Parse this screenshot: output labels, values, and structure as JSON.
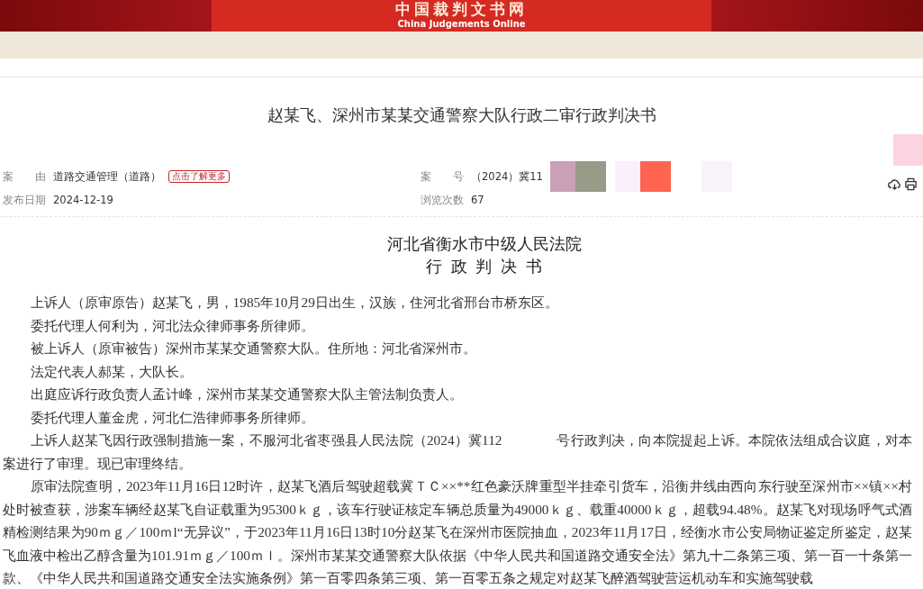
{
  "site": {
    "logo_text": "中国裁判文书网",
    "logo_subtitle": "China Judgements Online"
  },
  "document": {
    "title": "赵某飞、深州市某某交通警察大队行政二审行政判决书"
  },
  "meta": {
    "cause_label": "案　　由",
    "cause_value": "道路交通管理（道路）",
    "learn_more": "点击了解更多",
    "case_no_label": "案　　号",
    "case_no_value": "（2024）冀11",
    "date_label": "发布日期",
    "date_value": "2024-12-19",
    "views_label": "浏览次数",
    "views_value": "67"
  },
  "body": {
    "court": "河北省衡水市中级人民法院",
    "doc_type": "行政判决书",
    "paragraphs": [
      "上诉人（原审原告）赵某飞，男，1985年10月29日出生，汉族，住河北省邢台市桥东区。",
      "委托代理人何利为，河北法众律师事务所律师。",
      "被上诉人（原审被告）深州市某某交通警察大队。住所地：河北省深州市。",
      "法定代表人郝某，大队长。",
      "出庭应诉行政负责人孟计峰，深州市某某交通警察大队主管法制负责人。",
      "委托代理人董金虎，河北仁浩律师事务所律师。",
      "上诉人赵某飞因行政强制措施一案，不服河北省枣强县人民法院（2024）冀112　　　　号行政判决，向本院提起上诉。本院依法组成合议庭，对本案进行了审理。现已审理终结。",
      "原审法院查明，2023年11月16日12时许，赵某飞酒后驾驶超载冀ＴＣ××**红色豪沃牌重型半挂牵引货车，沿衡井线由西向东行驶至深州市××镇××村处时被查获，涉案车辆经赵某飞自证载重为95300ｋｇ，该车行驶证核定车辆总质量为49000ｋｇ、载重40000ｋｇ，超载94.48%。赵某飞对现场呼气式酒精检测结果为90ｍｇ／100ｍl“无异议”，于2023年11月16日13时10分赵某飞在深州市医院抽血，2023年11月17日，经衡水市公安局物证鉴定所鉴定，赵某飞血液中检出乙醇含量为101.91ｍｇ／100ｍｌ。深州市某某交通警察大队依据《中华人民共和国道路交通安全法》第九十二条第三项、第一百一十条第一款、《中华人民共和国道路交通安全法实施条例》第一百零四条第三项、第一百零五条之规定对赵某飞醉酒驾驶营运机动车和实施驾驶载"
    ]
  }
}
